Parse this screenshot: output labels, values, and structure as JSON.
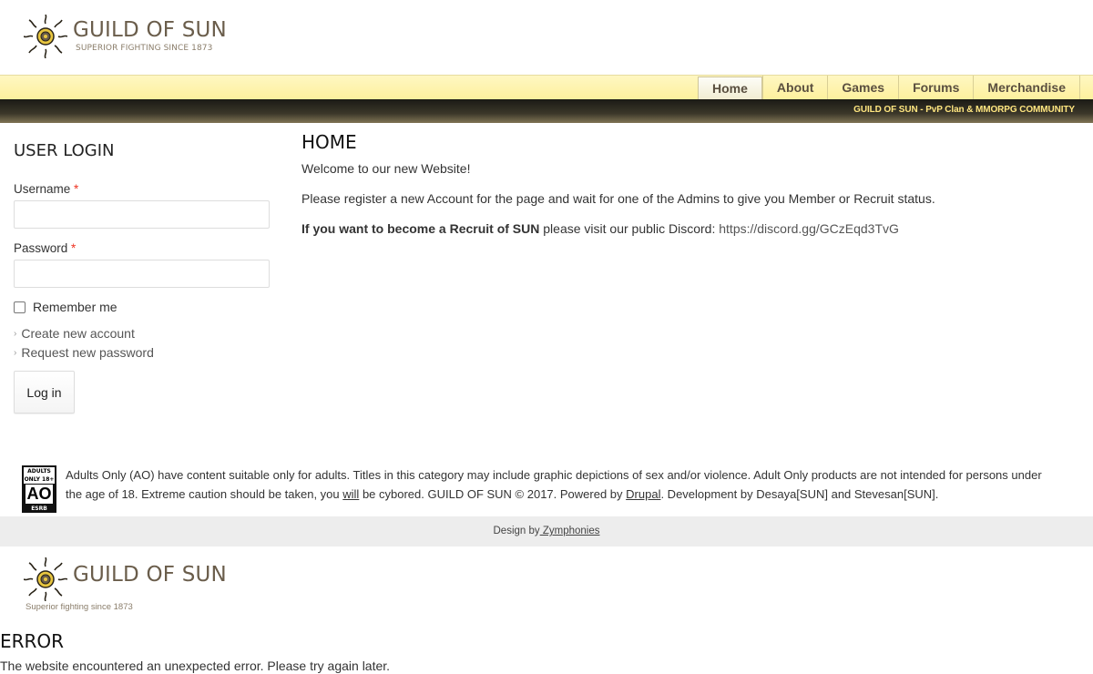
{
  "header": {
    "site_name": "GUILD OF SUN",
    "slogan": "SUPERIOR FIGHTING SINCE 1873"
  },
  "nav": {
    "items": [
      {
        "label": "Home",
        "active": true
      },
      {
        "label": "About",
        "active": false
      },
      {
        "label": "Games",
        "active": false
      },
      {
        "label": "Forums",
        "active": false
      },
      {
        "label": "Merchandise",
        "active": false
      }
    ]
  },
  "banner": {
    "text": "GUILD OF SUN - PvP Clan & MMORPG COMMUNITY"
  },
  "login": {
    "title": "USER LOGIN",
    "username_label": "Username",
    "password_label": "Password",
    "required_marker": "*",
    "remember_label": "Remember me",
    "create_account": "Create new account",
    "request_password": "Request new password",
    "login_button": "Log in"
  },
  "main": {
    "title": "HOME",
    "welcome": "Welcome to our new Website!",
    "register_text": "Please register a new Account for the page and wait for one of the Admins to give you Member or Recruit status.",
    "recruit_bold": "If you want to become a Recruit of SUN",
    "recruit_text": " please visit our public Discord: ",
    "discord_link": "https://discord.gg/GCzEqd3TvG"
  },
  "footer": {
    "rating": {
      "top": "ADULTS ONLY 18+",
      "letters": "AO",
      "bottom": "ESRB"
    },
    "text_part1": "Adults Only (AO) have content suitable only for adults. Titles in this category may include graphic depictions of sex and/or violence. Adult Only products are not intended for persons under the age of 18. Extreme caution should be taken, you ",
    "text_will": "will",
    "text_part2": " be cybored. GUILD OF SUN © 2017. Powered by ",
    "drupal": "Drupal",
    "text_part3": ". Development by Desaya[SUN] and Stevesan[SUN].",
    "design_label": "Design by",
    "design_link": " Zymphonies"
  },
  "error_section": {
    "site_name": "GUILD OF SUN",
    "slogan": "Superior fighting since 1873",
    "title": "ERROR",
    "message": "The website encountered an unexpected error. Please try again later."
  },
  "colors": {
    "nav_bg": "#fdf09c",
    "banner_text": "#ffe680",
    "title_brown": "#6a5d4b"
  }
}
